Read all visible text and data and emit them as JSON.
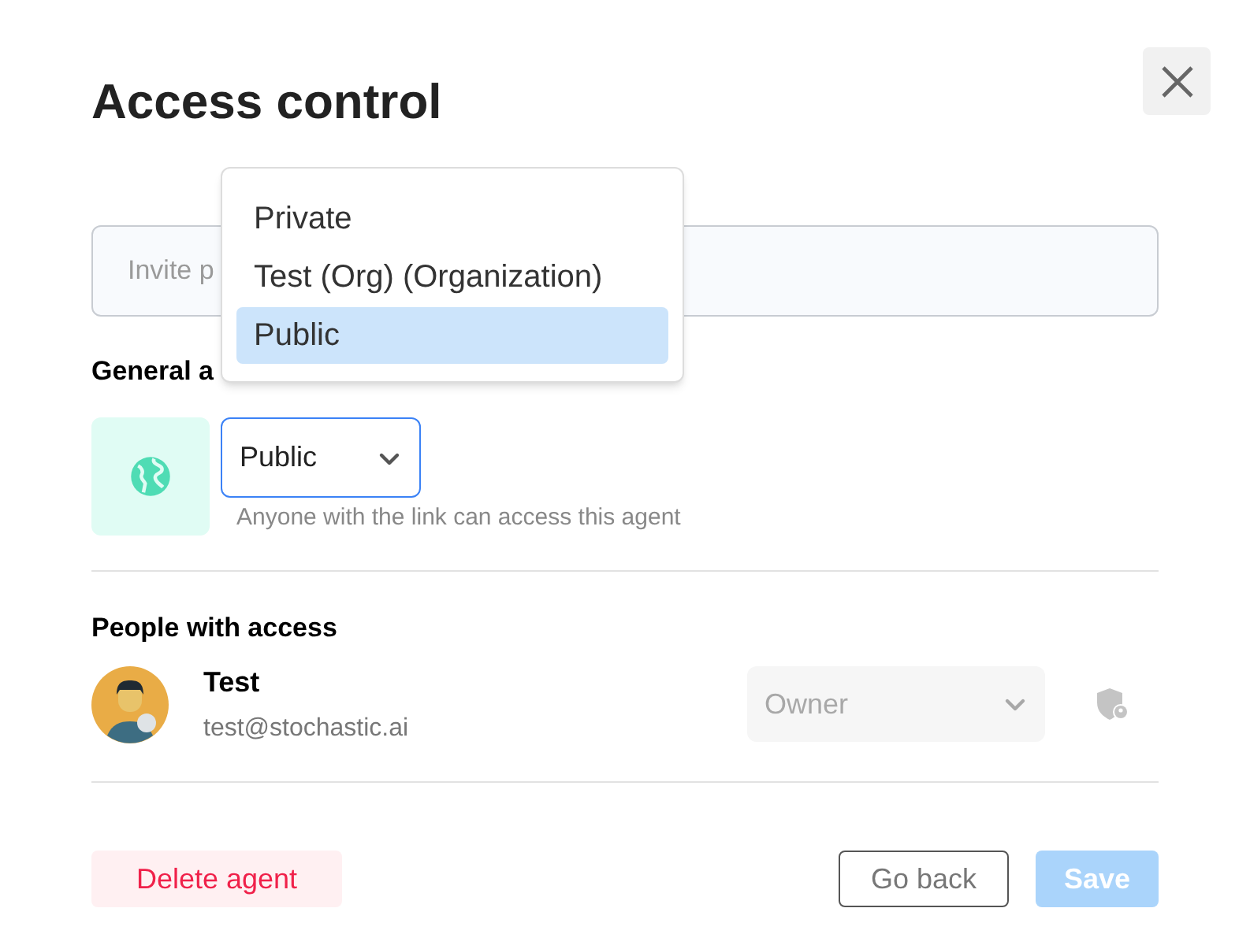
{
  "dialog": {
    "title": "Access control"
  },
  "invite": {
    "placeholder": "Invite p"
  },
  "general_access": {
    "heading": "General a",
    "value": "Public",
    "hint": "Anyone with the link can access this agent"
  },
  "visibility_menu": {
    "options": [
      {
        "label": "Private",
        "selected": false
      },
      {
        "label": "Test (Org) (Organization)",
        "selected": false
      },
      {
        "label": "Public",
        "selected": true
      }
    ]
  },
  "people": {
    "heading": "People with access",
    "members": [
      {
        "name": "Test",
        "email": "test@stochastic.ai",
        "role": "Owner",
        "disabled": true
      }
    ]
  },
  "buttons": {
    "delete": "Delete agent",
    "back": "Go back",
    "save": "Save",
    "save_disabled": true
  }
}
